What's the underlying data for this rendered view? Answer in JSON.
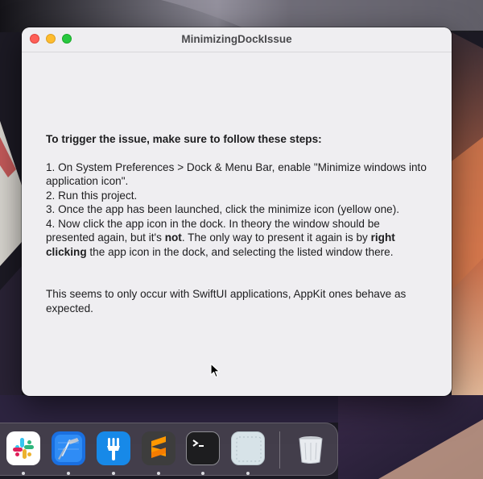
{
  "window": {
    "title": "MinimizingDockIssue",
    "heading": "To trigger the issue, make sure to follow these steps:",
    "steps": [
      "1. On System Preferences > Dock & Menu Bar, enable \"Minimize windows into application icon\".",
      "2. Run this project.",
      "3. Once the app has been launched, click the minimize icon (yellow one)."
    ],
    "step4": {
      "part1": "4. Now click the app icon in the dock. In theory the window should be presented again, but it's ",
      "bold1": "not",
      "part2": ". The only way to present it again is by ",
      "bold2": "right clicking",
      "part3": " the app icon in the dock, and selecting the listed window there."
    },
    "note": "This seems to only occur with SwiftUI applications, AppKit ones behave as expected."
  },
  "dock": {
    "apps": [
      {
        "icon": "slack-icon",
        "running": true
      },
      {
        "icon": "xcode-icon",
        "running": true
      },
      {
        "icon": "fork-icon",
        "running": true
      },
      {
        "icon": "sublime-text-icon",
        "running": true
      },
      {
        "icon": "terminal-icon",
        "running": true
      },
      {
        "icon": "minimized-app-icon",
        "running": true
      },
      {
        "icon": "trash-icon",
        "running": false
      }
    ]
  },
  "colors": {
    "close": "#fe5f57",
    "minimize": "#febc2e",
    "maximize": "#28c840",
    "window_bg": "#efeef1"
  }
}
